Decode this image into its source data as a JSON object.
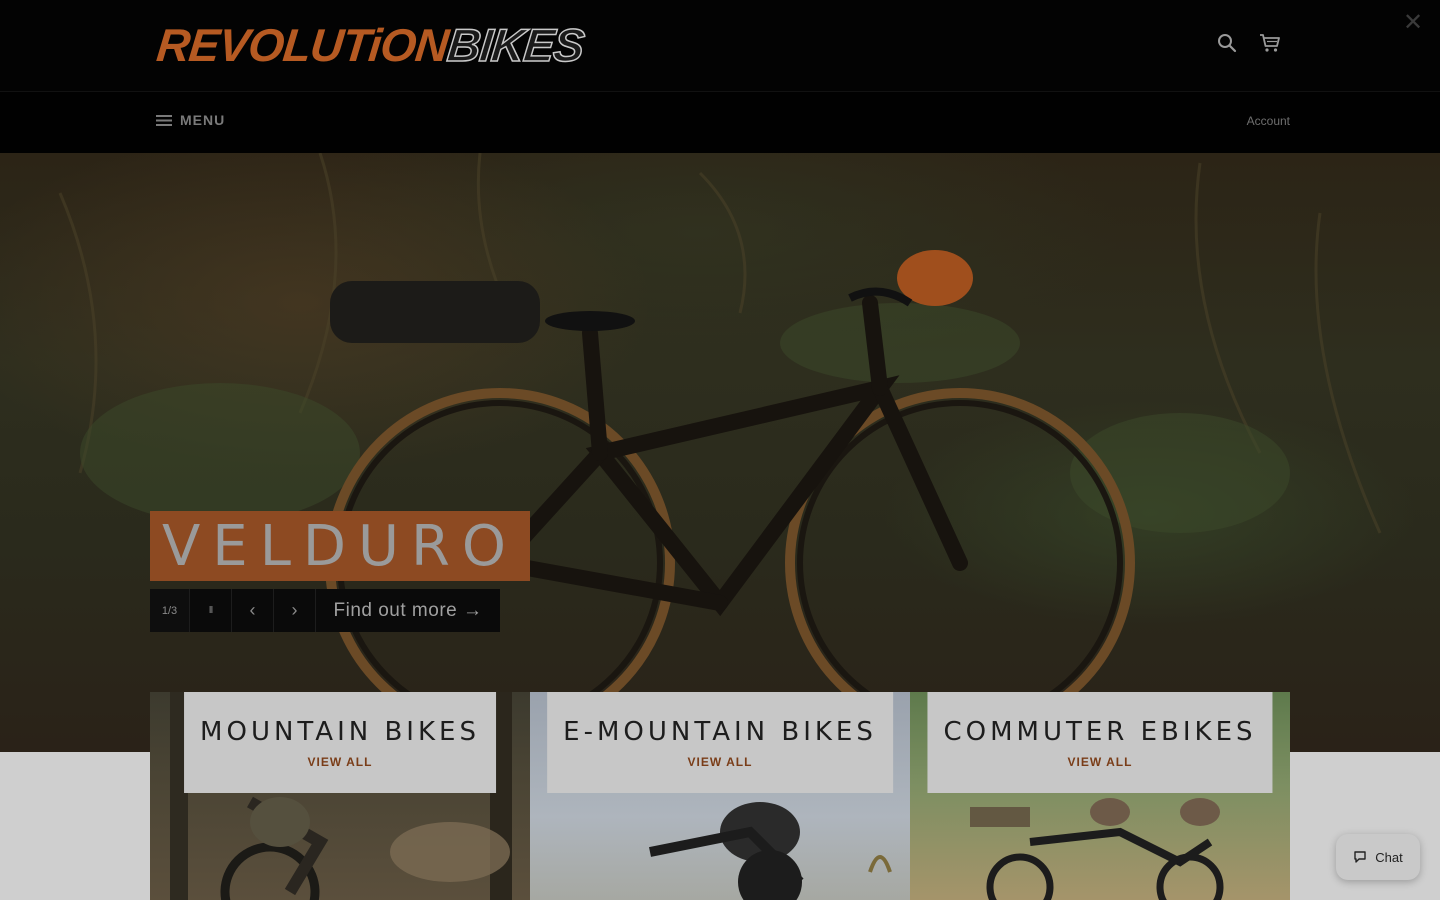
{
  "header": {
    "logo_part1": "REVOLUTiON",
    "logo_part2": "BIKES",
    "close_icon": "close-icon",
    "search_icon": "search-icon",
    "cart_icon": "cart-icon"
  },
  "nav": {
    "menu_label": "MENU",
    "account_label": "Account"
  },
  "hero": {
    "slide_title": "VELDURO",
    "slide_counter": "1/3",
    "pause_glyph": "II",
    "prev_glyph": "‹",
    "next_glyph": "›",
    "cta_label": "Find out more →",
    "accent_color": "#8d4a22"
  },
  "collections": [
    {
      "title": "MOUNTAIN BIKES",
      "link": "VIEW ALL"
    },
    {
      "title": "E-MOUNTAIN BIKES",
      "link": "VIEW ALL"
    },
    {
      "title": "COMMUTER EBIKES",
      "link": "VIEW ALL"
    }
  ],
  "chat": {
    "label": "Chat"
  }
}
